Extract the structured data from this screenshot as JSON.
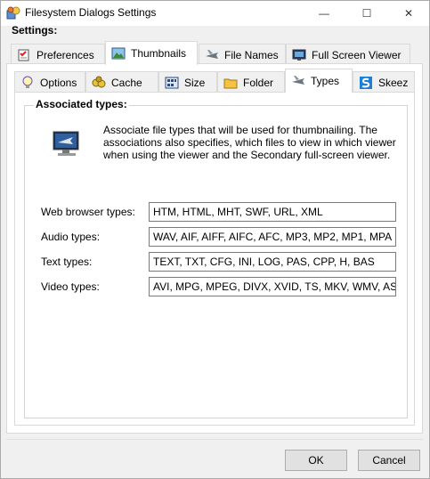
{
  "window": {
    "title": "Filesystem Dialogs Settings",
    "minimize_glyph": "—",
    "maximize_glyph": "☐",
    "close_glyph": "✕"
  },
  "settings_label": "Settings:",
  "outer_tabs": [
    {
      "label": "Preferences",
      "icon": "preferences-icon"
    },
    {
      "label": "Thumbnails",
      "icon": "thumbnails-icon",
      "active": true
    },
    {
      "label": "File Names",
      "icon": "file-names-icon"
    },
    {
      "label": "Full Screen Viewer",
      "icon": "full-screen-viewer-icon"
    }
  ],
  "inner_tabs": [
    {
      "label": "Options",
      "icon": "lightbulb-icon"
    },
    {
      "label": "Cache",
      "icon": "cache-icon"
    },
    {
      "label": "Size",
      "icon": "size-icon"
    },
    {
      "label": "Folder",
      "icon": "folder-icon"
    },
    {
      "label": "Types",
      "icon": "plane-icon",
      "active": true
    },
    {
      "label": "Skeez",
      "icon": "skeez-icon"
    }
  ],
  "group": {
    "title": "Associated types:",
    "description": "Associate file types that will be used for thumbnailing. The associations also specifies, which files to view in which viewer when using the viewer and the Secondary full-screen viewer."
  },
  "types": [
    {
      "label": "Web browser types:",
      "value": "HTM, HTML, MHT, SWF, URL, XML"
    },
    {
      "label": "Audio types:",
      "value": "WAV, AIF, AIFF, AIFC, AFC, MP3, MP2, MP1, MPA"
    },
    {
      "label": "Text types:",
      "value": "TEXT, TXT, CFG, INI, LOG, PAS, CPP, H, BAS"
    },
    {
      "label": "Video types:",
      "value": "AVI, MPG, MPEG, DIVX, XVID, TS, MKV, WMV, ASF"
    }
  ],
  "buttons": {
    "ok": "OK",
    "cancel": "Cancel"
  }
}
